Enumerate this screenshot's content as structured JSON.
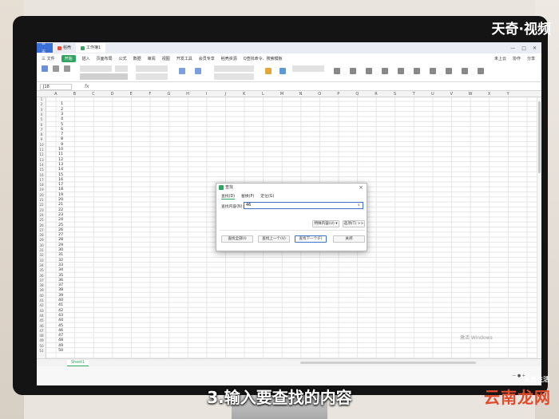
{
  "window": {
    "tabs": [
      {
        "label": "首页"
      },
      {
        "label": "稻壳"
      },
      {
        "label": "工作簿1"
      }
    ]
  },
  "menu": {
    "items": [
      "三 文件",
      "开始",
      "插入",
      "页面布局",
      "公式",
      "数据",
      "审阅",
      "视图",
      "开发工具",
      "会员专享",
      "稻壳资源"
    ],
    "active_label": "开始",
    "search": "Q查找命令、搜索模板",
    "right_items": [
      "未上云",
      "协作",
      "分享"
    ]
  },
  "formula_bar": {
    "name_box": "J18",
    "fx": "fx"
  },
  "columns": [
    "A",
    "B",
    "C",
    "D",
    "E",
    "F",
    "G",
    "H",
    "I",
    "J",
    "K",
    "L",
    "M",
    "N",
    "O",
    "P",
    "Q",
    "R",
    "S",
    "T",
    "U",
    "V",
    "W",
    "X",
    "Y"
  ],
  "rows": [
    "1",
    "2",
    "3",
    "4",
    "5",
    "6",
    "7",
    "8",
    "9",
    "10",
    "11",
    "12",
    "13",
    "14",
    "15",
    "16",
    "17",
    "18",
    "19",
    "20",
    "21",
    "22",
    "23",
    "24",
    "25",
    "26",
    "27",
    "28",
    "29",
    "30",
    "31",
    "32",
    "33",
    "34",
    "35",
    "36",
    "37",
    "38",
    "39",
    "40",
    "41",
    "42",
    "43",
    "44",
    "45",
    "46",
    "47",
    "48",
    "49",
    "50",
    "51"
  ],
  "colA_values": [
    "1",
    "2",
    "3",
    "4",
    "5",
    "6",
    "7",
    "8",
    "9",
    "10",
    "11",
    "12",
    "13",
    "14",
    "15",
    "16",
    "17",
    "18",
    "19",
    "20",
    "21",
    "22",
    "23",
    "24",
    "25",
    "26",
    "27",
    "28",
    "29",
    "30",
    "31",
    "32",
    "33",
    "34",
    "35",
    "36",
    "37",
    "38",
    "39",
    "40",
    "41",
    "42",
    "43",
    "44",
    "45",
    "46",
    "47",
    "48",
    "49",
    "50"
  ],
  "sheet": {
    "tab": "Sheet1",
    "watermark": "激活 Windows"
  },
  "dialog": {
    "title": "查找",
    "tabs": [
      "查找(D)",
      "替换(P)",
      "定位(G)"
    ],
    "find_label": "查找内容(N):",
    "find_value": "46",
    "options_format": "特殊内容(U) ▾",
    "options": "选项(T) >>",
    "buttons": [
      "查找全部(I)",
      "查找上一个(V)",
      "查找下一个(F)",
      "关闭"
    ]
  },
  "overlay": {
    "brand": "天奇·视频",
    "caption": "3.输入要查找的内容",
    "logo_small": "天奇生活",
    "logo_big": "云南龙网"
  }
}
